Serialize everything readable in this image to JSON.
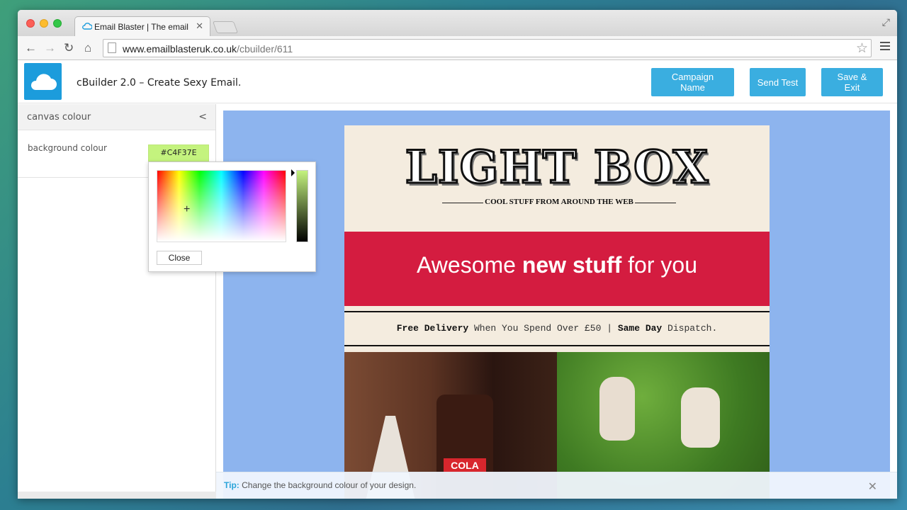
{
  "browser": {
    "tab_title": "Email Blaster | The email m",
    "url_host": "www.emailblasteruk.co.uk",
    "url_path": "/cbuilder/611"
  },
  "app": {
    "title": "cBuilder 2.0 – Create Sexy Email.",
    "buttons": {
      "campaign_name": "Campaign Name",
      "send_test": "Send Test",
      "save_exit": "Save & Exit"
    },
    "accent": "#3aaee0"
  },
  "sidebar": {
    "panel_title": "canvas colour",
    "collapse_glyph": "<",
    "background_label": "background colour",
    "background_value": "#C4F37E"
  },
  "picker": {
    "close_label": "Close"
  },
  "email": {
    "brand": "LIGHT BOX",
    "tagline": "COOL STUFF FROM AROUND THE WEB",
    "banner_pre": "Awesome ",
    "banner_bold": "new stuff",
    "banner_post": " for you",
    "delivery_bold_1": "Free Delivery",
    "delivery_mid": " When You Spend Over £50 | ",
    "delivery_bold_2": "Same Day",
    "delivery_end": " Dispatch.",
    "photo_label": "COLA",
    "banner_color": "#d41c40",
    "canvas_color": "#8db4ee"
  },
  "tip": {
    "label": "Tip:",
    "text": " Change the background colour of your design."
  }
}
